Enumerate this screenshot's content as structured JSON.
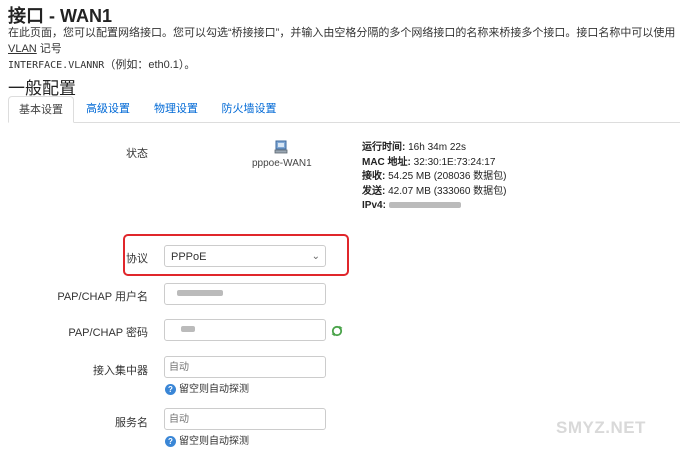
{
  "page": {
    "title": "接口 - WAN1",
    "description_1": "在此页面，您可以配置网络接口。您可以勾选“桥接接口”，并输入由空格分隔的多个网络接口的名称来桥接多个接口。接口名称中可以使用 ",
    "description_vlan": "VLAN",
    "description_2": " 记号",
    "description_3": "INTERFACE.VLANNR",
    "description_4": "（例如：eth0.1）。"
  },
  "section": {
    "title": "一般配置"
  },
  "tabs": [
    {
      "label": "基本设置",
      "active": true
    },
    {
      "label": "高级设置",
      "active": false
    },
    {
      "label": "物理设置",
      "active": false
    },
    {
      "label": "防火墙设置",
      "active": false
    }
  ],
  "status": {
    "label": "状态",
    "interface_name": "pppoe-WAN1",
    "icon": "network-interface-icon",
    "uptime_label": "运行时间:",
    "uptime_value": "16h 34m 22s",
    "mac_label": "MAC 地址:",
    "mac_value": "32:30:1E:73:24:17",
    "rx_label": "接收:",
    "rx_value": "54.25 MB (208036 数据包)",
    "tx_label": "发送:",
    "tx_value": "42.07 MB (333060 数据包)",
    "ipv4_label": "IPv4:"
  },
  "protocol": {
    "label": "协议",
    "value": "PPPoE"
  },
  "username": {
    "label": "PAP/CHAP 用户名"
  },
  "password": {
    "label": "PAP/CHAP 密码",
    "reveal_icon": "refresh-reveal-icon"
  },
  "concentrator": {
    "label": "接入集中器",
    "placeholder": "自动",
    "hint": "留空则自动探测"
  },
  "service": {
    "label": "服务名",
    "placeholder": "自动",
    "hint": "留空则自动探测"
  },
  "watermark": "SMYZ.NET",
  "colors": {
    "link": "#0069d6",
    "highlight_box": "#e0262b",
    "hint_icon": "#3a86d6"
  }
}
